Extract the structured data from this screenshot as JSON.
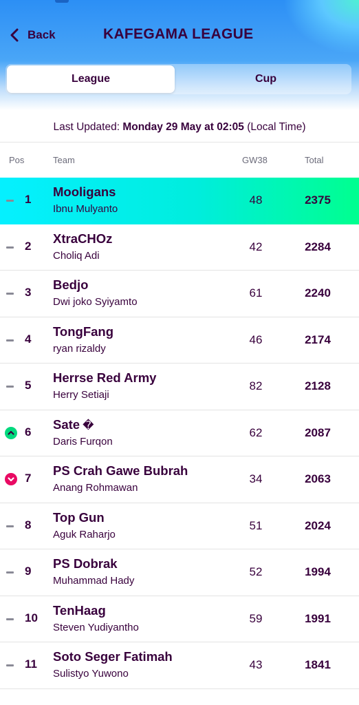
{
  "header": {
    "back_label": "Back",
    "title": "KAFEGAMA LEAGUE"
  },
  "tabs": [
    {
      "label": "League",
      "selected": true
    },
    {
      "label": "Cup",
      "selected": false
    }
  ],
  "updated": {
    "prefix": "Last Updated: ",
    "datetime": "Monday 29 May at 02:05",
    "suffix": " (Local Time)"
  },
  "columns": {
    "pos": "Pos",
    "team": "Team",
    "gw": "GW38",
    "total": "Total"
  },
  "colors": {
    "text": "#38003c",
    "highlight_start": "#05f0ff",
    "highlight_end": "#00ff8f",
    "up": "#01d97d",
    "down": "#e90a63"
  },
  "rows": [
    {
      "movement": "same",
      "pos": "1",
      "team": "Mooligans",
      "manager": "Ibnu Mulyanto",
      "gw": "48",
      "total": "2375",
      "highlight": true
    },
    {
      "movement": "same",
      "pos": "2",
      "team": "XtraCHOz",
      "manager": "Choliq Adi",
      "gw": "42",
      "total": "2284"
    },
    {
      "movement": "same",
      "pos": "3",
      "team": "Bedjo",
      "manager": "Dwi joko Syiyamto",
      "gw": "61",
      "total": "2240"
    },
    {
      "movement": "same",
      "pos": "4",
      "team": "TongFang",
      "manager": "ryan rizaldy",
      "gw": "46",
      "total": "2174"
    },
    {
      "movement": "same",
      "pos": "5",
      "team": "Herrse Red Army",
      "manager": "Herry Setiaji",
      "gw": "82",
      "total": "2128"
    },
    {
      "movement": "up",
      "pos": "6",
      "team": "Sate",
      "manager": "Daris Furqon",
      "gw": "62",
      "total": "2087",
      "team_glyph": "�"
    },
    {
      "movement": "down",
      "pos": "7",
      "team": "PS Crah Gawe Bubrah",
      "manager": "Anang Rohmawan",
      "gw": "34",
      "total": "2063"
    },
    {
      "movement": "same",
      "pos": "8",
      "team": "Top Gun",
      "manager": "Aguk Raharjo",
      "gw": "51",
      "total": "2024"
    },
    {
      "movement": "same",
      "pos": "9",
      "team": "PS Dobrak",
      "manager": "Muhammad Hady",
      "gw": "52",
      "total": "1994"
    },
    {
      "movement": "same",
      "pos": "10",
      "team": "TenHaag",
      "manager": "Steven Yudiyantho",
      "gw": "59",
      "total": "1991"
    },
    {
      "movement": "same",
      "pos": "11",
      "team": "Soto Seger Fatimah",
      "manager": "Sulistyo Yuwono",
      "gw": "43",
      "total": "1841"
    }
  ]
}
